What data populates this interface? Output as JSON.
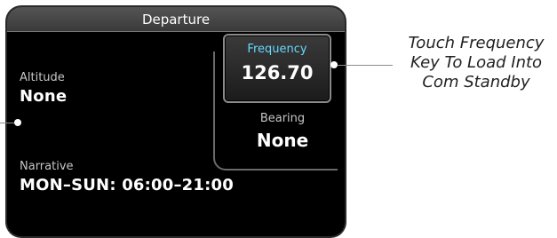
{
  "window": {
    "title": "Departure"
  },
  "fields": {
    "altitude": {
      "label": "Altitude",
      "value": "None"
    },
    "narrative": {
      "label": "Narrative",
      "value": "MON–SUN: 06:00–21:00"
    },
    "frequency": {
      "label": "Frequency",
      "value": "126.70"
    },
    "bearing": {
      "label": "Bearing",
      "value": "None"
    }
  },
  "callout": {
    "line1": "Touch Frequency",
    "line2": "Key To Load Into",
    "line3": "Com Standby"
  },
  "colors": {
    "frequency_label": "#66d8ff",
    "window_bg": "#000000",
    "title_bar": "#4a4a4a"
  }
}
